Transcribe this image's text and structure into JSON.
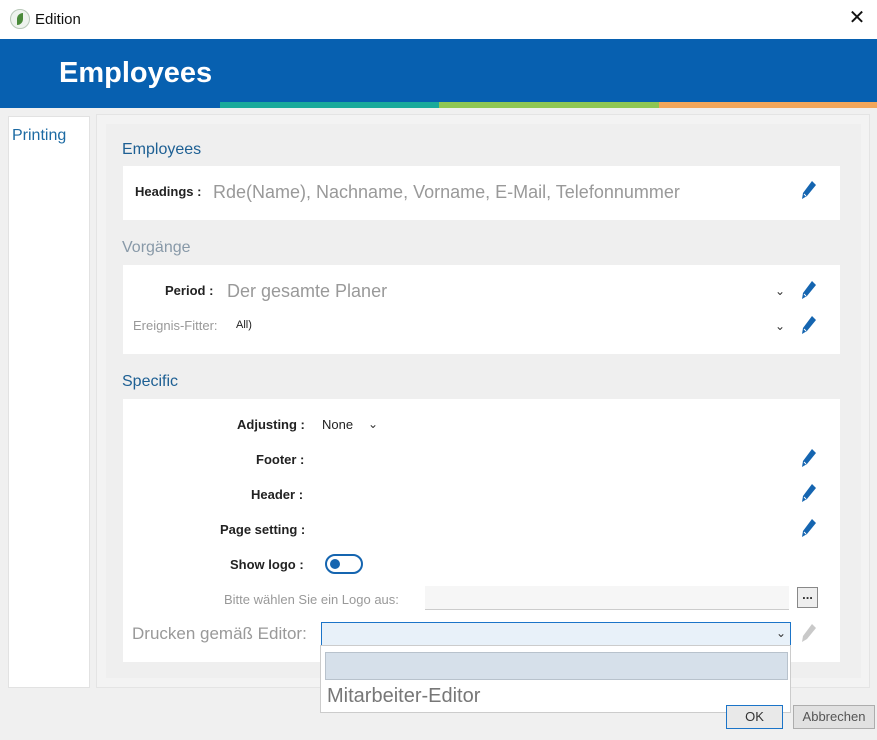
{
  "window": {
    "title": "Edition",
    "close_label": "✕"
  },
  "banner": {
    "title": "Employees",
    "stripe_colors": [
      "#1aaa9b",
      "#8fc653",
      "#f2a65a"
    ]
  },
  "sidebar": {
    "items": [
      {
        "label": "Printing"
      }
    ]
  },
  "employees": {
    "title": "Employees",
    "headings_label": "Headings :",
    "headings_value": "Rde(Name), Nachname, Vorname, E-Mail, Telefonnummer"
  },
  "vorgaenge": {
    "title": "Vorgänge",
    "period_label": "Period :",
    "period_value": "Der gesamte Planer",
    "filter_label": "Ereignis-Fitter:",
    "filter_value": "All)"
  },
  "specific": {
    "title": "Specific",
    "adjusting_label": "Adjusting :",
    "adjusting_value": "None",
    "footer_label": "Footer :",
    "header_label": "Header :",
    "page_setting_label": "Page setting :",
    "show_logo_label": "Show logo :",
    "logo_label": "Bitte wählen Sie ein Logo aus:",
    "logo_value": "",
    "browse_label": "...",
    "print_editor_label": "Drucken gemäß Editor:",
    "print_editor_value": ""
  },
  "dropdown": {
    "options": [
      "",
      "Mitarbeiter-Editor"
    ]
  },
  "buttons": {
    "ok": "OK",
    "cancel": "Abbrechen"
  },
  "colors": {
    "brand_blue": "#0760b0",
    "section_blue": "#1d5f93",
    "muted_section": "#8899a8",
    "pencil_blue": "#1565b0"
  },
  "toggles": {
    "show_logo_on": false
  }
}
